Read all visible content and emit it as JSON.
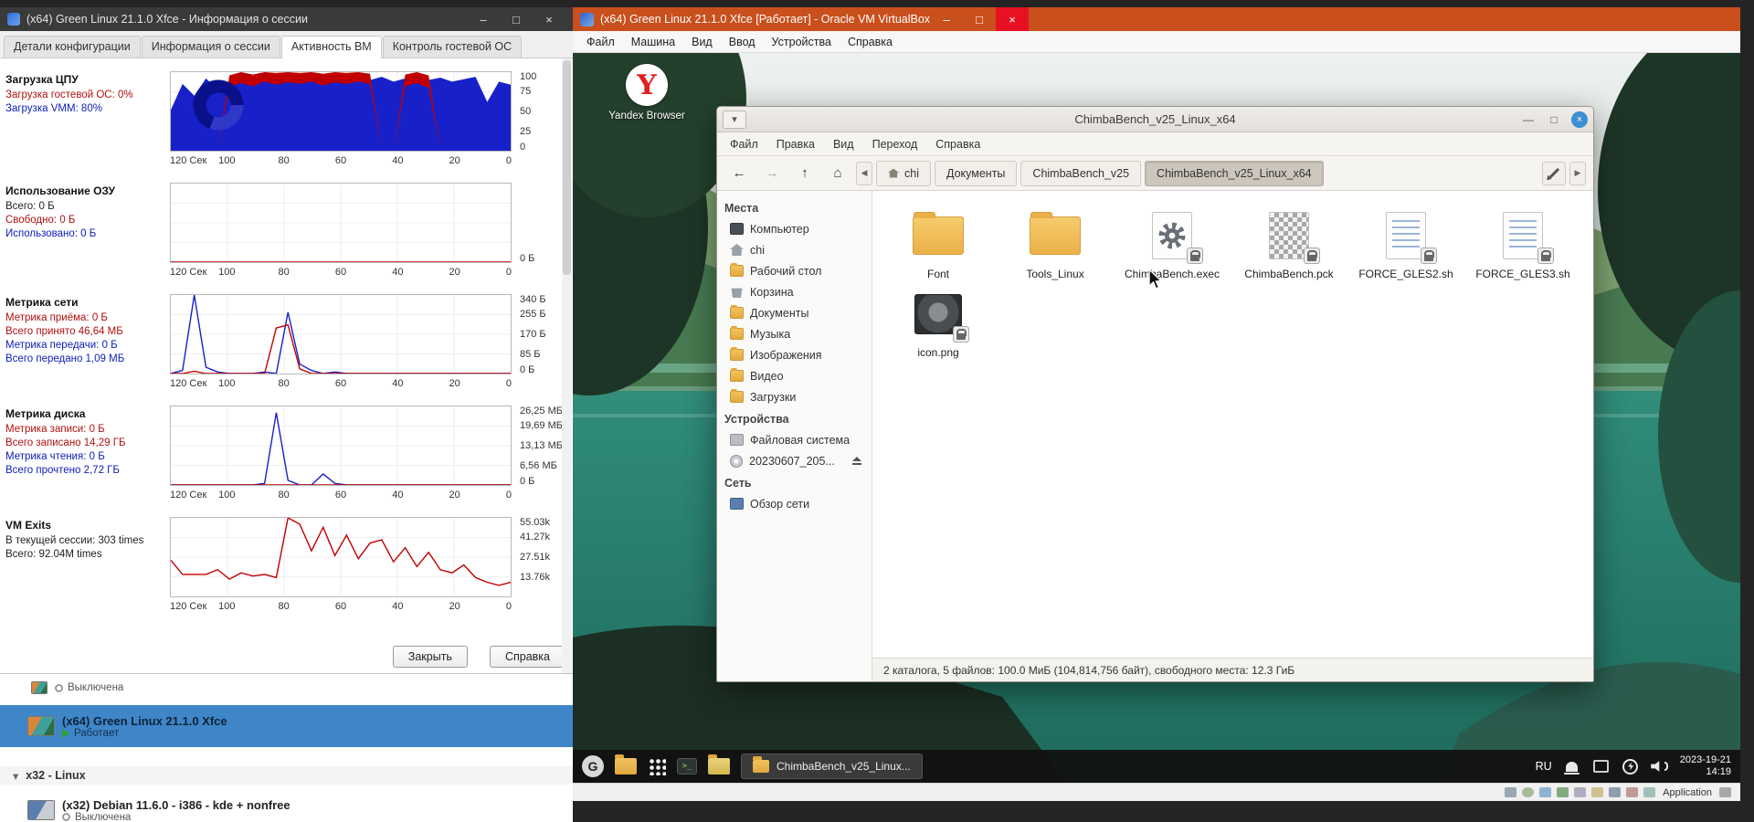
{
  "session": {
    "title": "(x64) Green Linux 21.1.0 Xfce - Информация о сессии",
    "tabs": [
      "Детали конфигурации",
      "Информация о сессии",
      "Активность ВМ",
      "Контроль гостевой ОС"
    ],
    "sections": {
      "cpu": {
        "title": "Загрузка ЦПУ",
        "line1": "Загрузка гостевой ОС: 0%",
        "line2": "Загрузка VMM: 80%"
      },
      "ram": {
        "title": "Использование ОЗУ",
        "line1": "Всего: 0 Б",
        "line2": "Свободно: 0 Б",
        "line3": "Использовано: 0 Б"
      },
      "net": {
        "title": "Метрика сети",
        "line1": "Метрика приёма: 0 Б",
        "line2": "Всего принято 46,64 МБ",
        "line3": "Метрика передачи: 0 Б",
        "line4": "Всего передано 1,09 МБ"
      },
      "disk": {
        "title": "Метрика диска",
        "line1": "Метрика записи: 0 Б",
        "line2": "Всего записано 14,29 ГБ",
        "line3": "Метрика чтения: 0 Б",
        "line4": "Всего прочтено 2,72 ГБ"
      },
      "vmx": {
        "title": "VM Exits",
        "line1": "В текущей сессии: 303 times",
        "line2": "Всего: 92.04M times"
      }
    },
    "close_button": "Закрыть",
    "help_button": "Справка"
  },
  "manager": {
    "row_partial_status": "Выключена",
    "selected_name": "(x64) Green Linux 21.1.0 Xfce",
    "selected_status": "Работает",
    "group_label": "x32 - Linux",
    "row2_name": "(x32) Debian 11.6.0 - i386 - kde + nonfree",
    "row2_status": "Выключена"
  },
  "vm": {
    "title": "(x64) Green Linux 21.1.0 Xfce [Работает] - Oracle VM VirtualBox",
    "menu": [
      "Файл",
      "Машина",
      "Вид",
      "Ввод",
      "Устройства",
      "Справка"
    ],
    "desktop_icon_label": "Yandex Browser",
    "status_text": "Application"
  },
  "thunar": {
    "title": "ChimbaBench_v25_Linux_x64",
    "menu": [
      "Файл",
      "Правка",
      "Вид",
      "Переход",
      "Справка"
    ],
    "crumbs": [
      "chi",
      "Документы",
      "ChimbaBench_v25",
      "ChimbaBench_v25_Linux_x64"
    ],
    "sidebar": {
      "places_header": "Места",
      "places": [
        "Компьютер",
        "chi",
        "Рабочий стол",
        "Корзина",
        "Документы",
        "Музыка",
        "Изображения",
        "Видео",
        "Загрузки"
      ],
      "devices_header": "Устройства",
      "devices": [
        "Файловая система",
        "20230607_205..."
      ],
      "network_header": "Сеть",
      "network": [
        "Обзор сети"
      ]
    },
    "files": [
      {
        "name": "Font"
      },
      {
        "name": "Tools_Linux"
      },
      {
        "name": "ChimbaBench.exec"
      },
      {
        "name": "ChimbaBench.pck"
      },
      {
        "name": "FORCE_GLES2.sh"
      },
      {
        "name": "FORCE_GLES3.sh"
      },
      {
        "name": "icon.png"
      }
    ],
    "status": "2 каталога, 5 файлов: 100.0 МиБ (104,814,756 байт), свободного места: 12.3 ГиБ"
  },
  "taskbar": {
    "task_label": "ChimbaBench_v25_Linux...",
    "lang": "RU",
    "clock_date": "2023-19-21",
    "clock_time": "14:19"
  },
  "colors": {
    "accent_blue": "#1821c9",
    "accent_red": "#c00000",
    "selection_blue": "#3f86c9",
    "titlebar_orange": "#c94f1c"
  },
  "chart_data": {
    "cpu": {
      "type": "area",
      "title": "Загрузка ЦПУ (%)",
      "xticks": [
        "120 Сек",
        "100",
        "80",
        "60",
        "40",
        "20",
        "0"
      ],
      "ylabels": [
        {
          "t": "100",
          "p": 0
        },
        {
          "t": "75",
          "p": 25
        },
        {
          "t": "50",
          "p": 50
        },
        {
          "t": "25",
          "p": 75
        },
        {
          "t": "0",
          "p": 100
        }
      ],
      "ylim": [
        0,
        100
      ],
      "series": [
        {
          "name": "Загрузка VMM",
          "type": "area",
          "color": "#1821c9",
          "values": [
            52,
            85,
            70,
            92,
            78,
            88,
            95,
            82,
            90,
            94,
            88,
            96,
            90,
            95,
            88,
            92,
            96,
            90,
            94,
            88,
            92,
            95,
            90,
            93,
            88,
            91,
            94,
            62,
            88,
            84
          ]
        },
        {
          "name": "Загрузка гостевой ОС",
          "type": "band",
          "color": "#c00000",
          "upper": [
            0,
            0,
            0,
            0,
            0,
            96,
            100,
            97,
            100,
            99,
            100,
            99,
            100,
            98,
            100,
            99,
            100,
            98,
            0,
            0,
            97,
            100,
            96,
            0,
            0,
            0,
            0,
            0,
            0,
            0
          ],
          "lower": [
            0,
            0,
            0,
            0,
            0,
            82,
            86,
            82,
            88,
            84,
            87,
            85,
            88,
            83,
            87,
            85,
            88,
            85,
            0,
            0,
            82,
            86,
            80,
            0,
            0,
            0,
            0,
            0,
            0,
            0
          ]
        }
      ]
    },
    "ram": {
      "type": "line",
      "title": "Использование ОЗУ",
      "xticks": [
        "120 Сек",
        "100",
        "80",
        "60",
        "40",
        "20",
        "0"
      ],
      "ylabels": [
        {
          "t": "0 Б",
          "p": 100
        }
      ],
      "series": [
        {
          "name": "Использование ОЗУ",
          "type": "line",
          "color": "#c00000",
          "values": [
            0,
            0
          ]
        }
      ]
    },
    "net": {
      "type": "line",
      "title": "Метрика сети",
      "xticks": [
        "120 Сек",
        "100",
        "80",
        "60",
        "40",
        "20",
        "0"
      ],
      "ylabels": [
        {
          "t": "340 Б",
          "p": 0
        },
        {
          "t": "255 Б",
          "p": 25
        },
        {
          "t": "170 Б",
          "p": 50
        },
        {
          "t": "85 Б",
          "p": 75
        },
        {
          "t": "0 Б",
          "p": 100
        }
      ],
      "series": [
        {
          "name": "Метрика передачи",
          "type": "line",
          "color": "#1821c9",
          "values": [
            0,
            4,
            100,
            8,
            2,
            0,
            0,
            0,
            2,
            0,
            78,
            12,
            4,
            0,
            2,
            0,
            0,
            0,
            0,
            0,
            0,
            0,
            0,
            0,
            0,
            0,
            0,
            0,
            0,
            0
          ]
        },
        {
          "name": "Метрика приёма",
          "type": "line",
          "color": "#c00000",
          "values": [
            0,
            0,
            3,
            0,
            0,
            0,
            0,
            0,
            0,
            58,
            62,
            6,
            0,
            0,
            0,
            0,
            0,
            0,
            0,
            0,
            0,
            0,
            0,
            0,
            0,
            0,
            0,
            0,
            0,
            0
          ]
        }
      ]
    },
    "disk": {
      "type": "line",
      "title": "Метрика диска",
      "xticks": [
        "120 Сек",
        "100",
        "80",
        "60",
        "40",
        "20",
        "0"
      ],
      "ylabels": [
        {
          "t": "26,25 МБ",
          "p": 0
        },
        {
          "t": "19,69 МБ",
          "p": 25
        },
        {
          "t": "13,13 МБ",
          "p": 50
        },
        {
          "t": "6,56 МБ",
          "p": 75
        },
        {
          "t": "0 Б",
          "p": 100
        }
      ],
      "series": [
        {
          "name": "Метрика чтения",
          "type": "line",
          "color": "#1821c9",
          "values": [
            0,
            0,
            0,
            0,
            0,
            0,
            0,
            0,
            2,
            92,
            6,
            0,
            0,
            14,
            2,
            0,
            0,
            0,
            0,
            0,
            0,
            0,
            0,
            0,
            0,
            0,
            0,
            0,
            0,
            0
          ]
        },
        {
          "name": "Метрика записи",
          "type": "line",
          "color": "#c00000",
          "values": [
            0,
            0
          ]
        }
      ]
    },
    "vmx": {
      "type": "line",
      "title": "VM Exits",
      "xticks": [
        "120 Сек",
        "100",
        "80",
        "60",
        "40",
        "20",
        "0"
      ],
      "ylabels": [
        {
          "t": "55.03k",
          "p": 0
        },
        {
          "t": "41.27k",
          "p": 25
        },
        {
          "t": "27.51k",
          "p": 50
        },
        {
          "t": "13.76k",
          "p": 75
        }
      ],
      "series": [
        {
          "name": "VM Exits",
          "type": "line",
          "color": "#c00000",
          "values": [
            46,
            28,
            28,
            28,
            34,
            22,
            30,
            26,
            28,
            24,
            100,
            92,
            58,
            88,
            52,
            78,
            48,
            68,
            72,
            44,
            62,
            38,
            56,
            34,
            30,
            40,
            24,
            18,
            14,
            18
          ]
        }
      ]
    }
  }
}
